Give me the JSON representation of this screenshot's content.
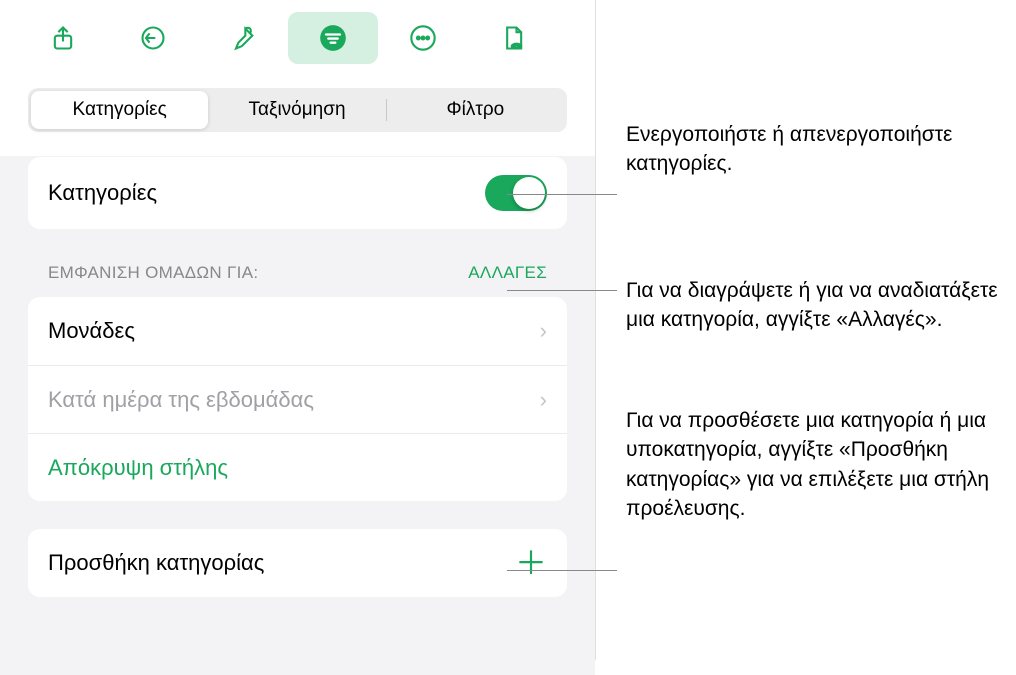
{
  "colors": {
    "accent": "#1aa85c",
    "panel_bg": "#f3f3f5"
  },
  "toolbar": {
    "share": "share",
    "undo": "undo",
    "brush": "brush",
    "organize": "organize",
    "more": "more",
    "doc": "doc"
  },
  "segmented": {
    "tab1": "Κατηγορίες",
    "tab2": "Ταξινόμηση",
    "tab3": "Φίλτρο"
  },
  "categories_toggle": {
    "label": "Κατηγορίες",
    "on": true
  },
  "groups": {
    "title": "ΕΜΦΑΝΙΣΗ ΟΜΑΔΩΝ ΓΙΑ:",
    "edit": "ΑΛΛΑΓΕΣ",
    "items": [
      {
        "label": "Μονάδες",
        "enabled": true
      },
      {
        "label": "Κατά ημέρα της εβδομάδας",
        "enabled": false
      }
    ],
    "hide_column": "Απόκρυψη στήλης"
  },
  "add_category": {
    "label": "Προσθήκη κατηγορίας"
  },
  "annotations": {
    "toggle": "Ενεργοποιήστε ή απενεργοποιήστε κατηγορίες.",
    "edit": "Για να διαγράψετε ή για να αναδιατάξετε μια κατηγορία, αγγίξτε «Αλλαγές».",
    "add": "Για να προσθέσετε μια κατηγορία ή μια υποκατηγορία, αγγίξτε «Προσθήκη κατηγορίας» για να επιλέξετε μια στήλη προέλευσης."
  }
}
